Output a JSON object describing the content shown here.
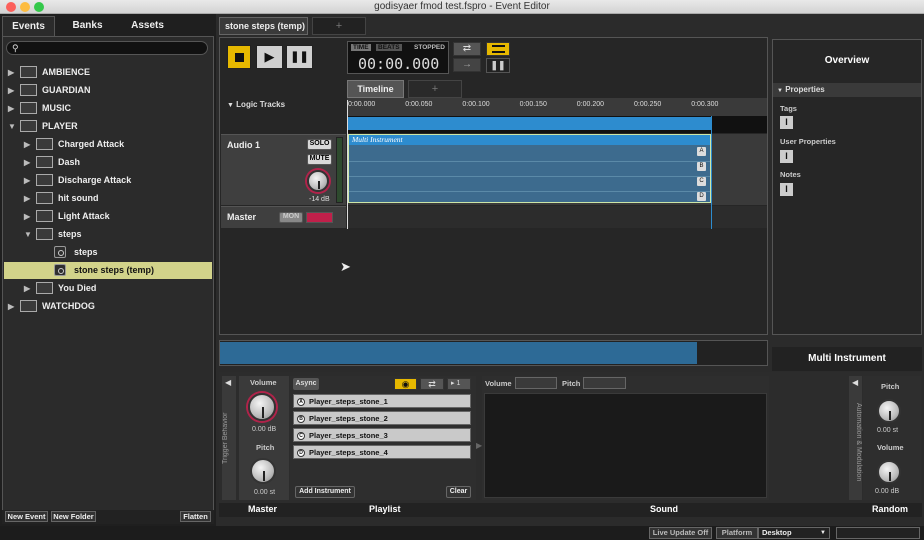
{
  "window": {
    "title": "godisyaer fmod test.fspro - Event Editor"
  },
  "browser": {
    "tabs": [
      "Events",
      "Banks",
      "Assets"
    ],
    "search_icon": "search-icon",
    "search_placeholder": "",
    "items": [
      {
        "label": "AMBIENCE",
        "type": "folder",
        "expanded": false
      },
      {
        "label": "GUARDIAN",
        "type": "folder",
        "expanded": false
      },
      {
        "label": "MUSIC",
        "type": "folder",
        "expanded": false
      },
      {
        "label": "PLAYER",
        "type": "folder",
        "expanded": true
      },
      {
        "label": "Charged Attack",
        "type": "folder",
        "expanded": false
      },
      {
        "label": "Dash",
        "type": "folder",
        "expanded": false
      },
      {
        "label": "Discharge Attack",
        "type": "folder",
        "expanded": false
      },
      {
        "label": "hit sound",
        "type": "folder",
        "expanded": false
      },
      {
        "label": "Light Attack",
        "type": "folder",
        "expanded": false
      },
      {
        "label": "steps",
        "type": "folder",
        "expanded": true
      },
      {
        "label": "steps",
        "type": "event"
      },
      {
        "label": "stone steps (temp)",
        "type": "event",
        "selected": true
      },
      {
        "label": "You Died",
        "type": "folder",
        "expanded": false
      },
      {
        "label": "WATCHDOG",
        "type": "folder",
        "expanded": false
      }
    ],
    "footer": {
      "new_event": "New Event",
      "new_folder": "New Folder",
      "flatten": "Flatten"
    }
  },
  "editor": {
    "tab": "stone steps (temp)",
    "add_tab": "+",
    "transport": {
      "time_label": "TIME",
      "beats_label": "BEATS",
      "state": "STOPPED",
      "time": "00:00.000"
    },
    "timeline": {
      "tab": "Timeline",
      "add_tab": "+",
      "logic_tracks": "Logic Tracks",
      "ticks": [
        "0:00.000",
        "0:00.050",
        "0:00.100",
        "0:00.150",
        "0:00.200",
        "0:00.250",
        "0:00.300"
      ]
    },
    "tracks": [
      {
        "name": "Audio 1",
        "solo": "SOLO",
        "mute": "MUTE",
        "volume": "-14 dB"
      },
      {
        "name": "Master",
        "mon": "MON"
      }
    ],
    "instrument_region": {
      "label": "Multi Instrument",
      "lanes": [
        "A",
        "B",
        "C",
        "D"
      ]
    }
  },
  "overview": {
    "title": "Overview",
    "properties": "Properties",
    "tags": "Tags",
    "user_properties": "User Properties",
    "notes": "Notes"
  },
  "deck": {
    "master": {
      "title": "Master",
      "volume_label": "Volume",
      "volume": "0.00 dB",
      "pitch_label": "Pitch",
      "pitch": "0.00 st"
    },
    "trigger_behavior": "Trigger Behavior",
    "playlist": {
      "title": "Playlist",
      "async": "Async",
      "count": "1",
      "items": [
        "Player_steps_stone_1",
        "Player_steps_stone_2",
        "Player_steps_stone_3",
        "Player_steps_stone_4"
      ],
      "item_icons": [
        "A",
        "B",
        "C",
        "D"
      ],
      "add": "Add Instrument",
      "clear": "Clear"
    },
    "sound": {
      "title": "Sound",
      "volume_label": "Volume",
      "pitch_label": "Pitch"
    },
    "random": {
      "title": "Random",
      "header": "Multi Instrument",
      "automation": "Automation & Modulation",
      "pitch_label": "Pitch",
      "pitch": "0.00 st",
      "volume_label": "Volume",
      "volume": "0.00 dB"
    }
  },
  "statusbar": {
    "live_update": "Live Update Off",
    "platform_label": "Platform",
    "platform": "Desktop"
  }
}
